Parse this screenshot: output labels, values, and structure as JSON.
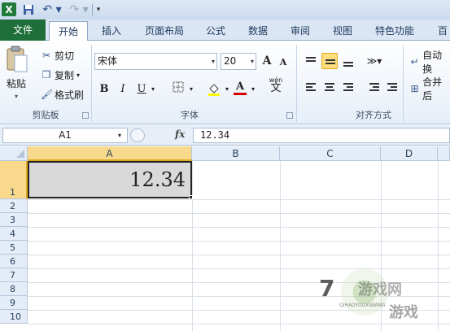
{
  "titlebar": {
    "app_icon": "excel-icon",
    "logo_letter": "X",
    "undo_glyph": "↶ ▾",
    "redo_glyph": "↷ ▾",
    "customize_glyph": "▾"
  },
  "tabs": [
    {
      "label": "文件"
    },
    {
      "label": "开始"
    },
    {
      "label": "插入"
    },
    {
      "label": "页面布局"
    },
    {
      "label": "公式"
    },
    {
      "label": "数据"
    },
    {
      "label": "审阅"
    },
    {
      "label": "视图"
    },
    {
      "label": "特色功能"
    },
    {
      "label": "百"
    }
  ],
  "clipboard": {
    "paste": "粘贴",
    "cut": "剪切",
    "copy": "复制",
    "format_painter": "格式刷",
    "group": "剪贴板"
  },
  "font": {
    "name": "宋体",
    "size": "20",
    "grow": "A",
    "shrink": "A",
    "bold": "B",
    "italic": "I",
    "underline": "U",
    "font_color": "A",
    "wen": "wén",
    "wen_char": "文",
    "group": "字体"
  },
  "alignment": {
    "wrap": "自动换",
    "merge": "合并后",
    "group": "对齐方式"
  },
  "formula_bar": {
    "name_box": "A1",
    "fx": "fx",
    "value": "12.34"
  },
  "grid": {
    "columns": [
      "A",
      "B",
      "C",
      "D"
    ],
    "rows": [
      "1",
      "2",
      "3",
      "4",
      "5",
      "6",
      "7",
      "8",
      "9",
      "10"
    ],
    "cell_a1": "12.34"
  },
  "watermark": {
    "num": "7",
    "text1": "游戏网",
    "text2": "游戏",
    "url": "QIHAOYOUXIWANG"
  },
  "colors": {
    "file_tab": "#1f6f3a",
    "selection_header": "#f9d98b",
    "active_align": "#ffdf7d"
  }
}
